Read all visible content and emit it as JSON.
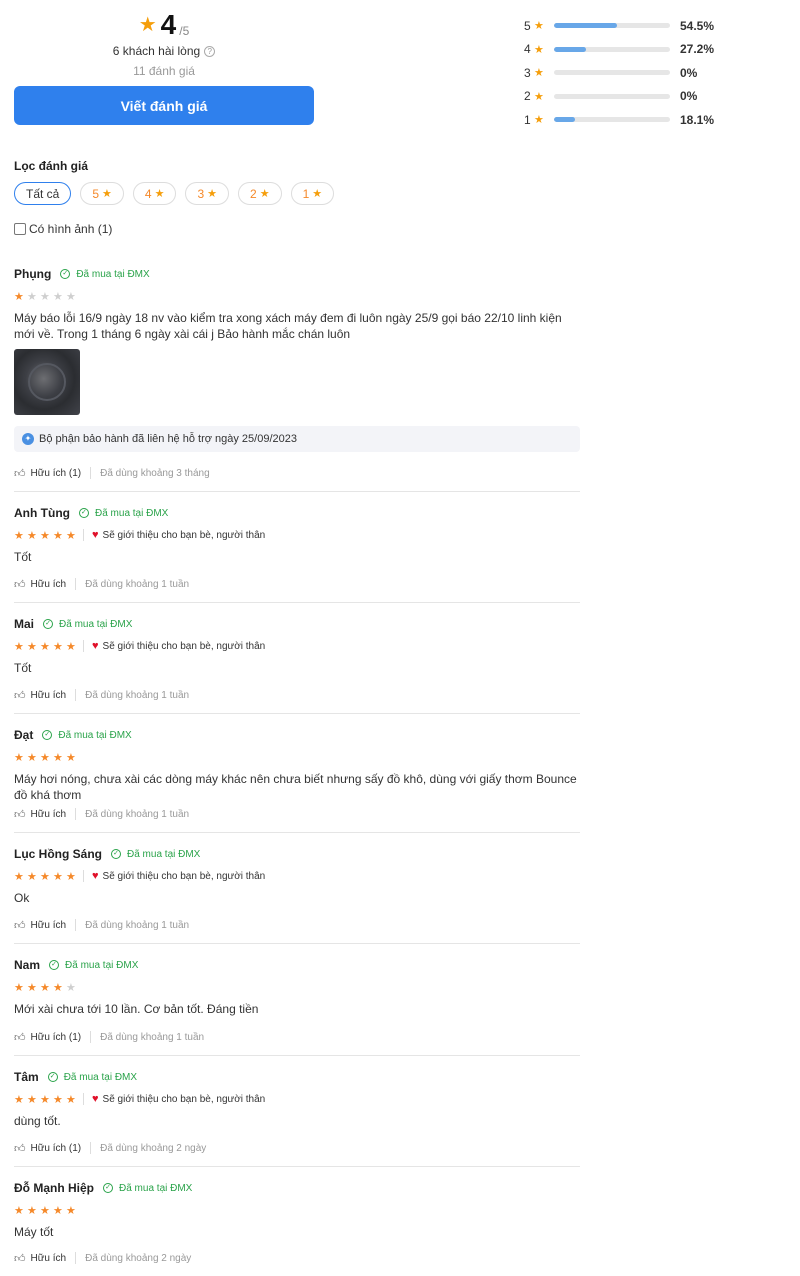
{
  "summary": {
    "score": "4",
    "score_max": "/5",
    "satisfied": "6 khách hài lòng",
    "count": "11 đánh giá",
    "write_label": "Viết đánh giá"
  },
  "distribution": [
    {
      "star": "5",
      "fraction": 0.545,
      "pct": "54.5%"
    },
    {
      "star": "4",
      "fraction": 0.272,
      "pct": "27.2%"
    },
    {
      "star": "3",
      "fraction": 0,
      "pct": "0%"
    },
    {
      "star": "2",
      "fraction": 0,
      "pct": "0%"
    },
    {
      "star": "1",
      "fraction": 0.181,
      "pct": "18.1%"
    }
  ],
  "filter": {
    "title": "Lọc đánh giá",
    "chips": [
      "Tất cả",
      "5",
      "4",
      "3",
      "2",
      "1"
    ],
    "has_image_label": "Có hình ảnh (1)"
  },
  "verified_label": "Đã mua tại ĐMX",
  "recommend_label": "Sẽ giới thiệu cho bạn bè, người thân",
  "reviews": [
    {
      "name": "Phụng",
      "stars": 1,
      "recommend": false,
      "text": "Máy báo lỗi 16/9 ngày 18 nv vào kiểm tra xong xách máy đem đi luôn ngày 25/9 gọi báo 22/10 linh kiện mới về. Trong 1 tháng 6 ngày xài cái j Bảo hành mắc chán luôn",
      "has_photo": true,
      "reply": "Bộ phận bảo hành đã liên hệ hỗ trợ ngày 25/09/2023",
      "helpful": "Hữu ích (1)",
      "used": "Đã dùng khoảng 3 tháng"
    },
    {
      "name": "Anh Tùng",
      "stars": 5,
      "recommend": true,
      "text": "Tốt",
      "helpful": "Hữu ích",
      "used": "Đã dùng khoảng 1 tuần"
    },
    {
      "name": "Mai",
      "stars": 5,
      "recommend": true,
      "text": "Tốt",
      "helpful": "Hữu ích",
      "used": "Đã dùng khoảng 1 tuần"
    },
    {
      "name": "Đạt",
      "stars": 5,
      "recommend": false,
      "text": "Máy hơi nóng, chưa xài các dòng máy khác nên chưa biết nhưng sấy đồ khô, dùng với giấy thơm Bounce đồ khá thơm",
      "helpful": "Hữu ích",
      "used": "Đã dùng khoảng 1 tuần"
    },
    {
      "name": "Lục Hồng Sáng",
      "stars": 5,
      "recommend": true,
      "text": "Ok",
      "helpful": "Hữu ích",
      "used": "Đã dùng khoảng 1 tuần"
    },
    {
      "name": "Nam",
      "stars": 4,
      "recommend": false,
      "text": "Mới xài chưa tới 10 lần. Cơ bản tốt. Đáng tiền",
      "helpful": "Hữu ích (1)",
      "used": "Đã dùng khoảng 1 tuần"
    },
    {
      "name": "Tâm",
      "stars": 5,
      "recommend": true,
      "text": "dùng tốt.",
      "helpful": "Hữu ích (1)",
      "used": "Đã dùng khoảng 2 ngày"
    },
    {
      "name": "Đỗ Mạnh Hiệp",
      "stars": 5,
      "recommend": false,
      "text": "Máy tốt",
      "helpful": "Hữu ích",
      "used": "Đã dùng khoảng 2 ngày"
    }
  ]
}
